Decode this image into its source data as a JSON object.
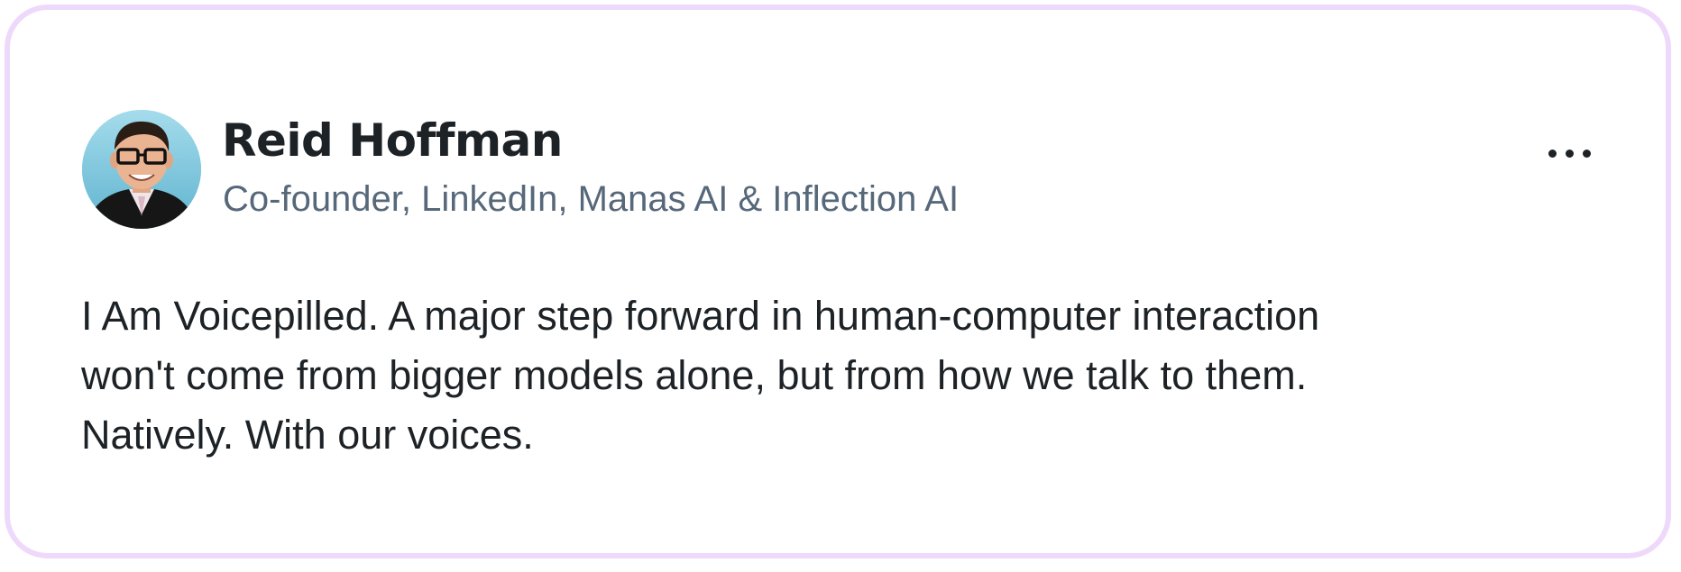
{
  "post": {
    "author": {
      "name": "Reid Hoffman",
      "headline": "Co-founder, LinkedIn, Manas AI & Inflection AI",
      "avatar": "profile-photo"
    },
    "more_icon": "ellipsis-icon",
    "body_lines": [
      "I Am Voicepilled. A major step forward in human-computer interaction",
      "won't come from bigger models alone, but from how we talk to them.",
      "Natively. With our voices."
    ]
  },
  "colors": {
    "card_border": "#efd9fb",
    "name_text": "#1d2226",
    "headline_text": "#56687a",
    "body_text": "#1d2226",
    "background": "#ffffff"
  }
}
